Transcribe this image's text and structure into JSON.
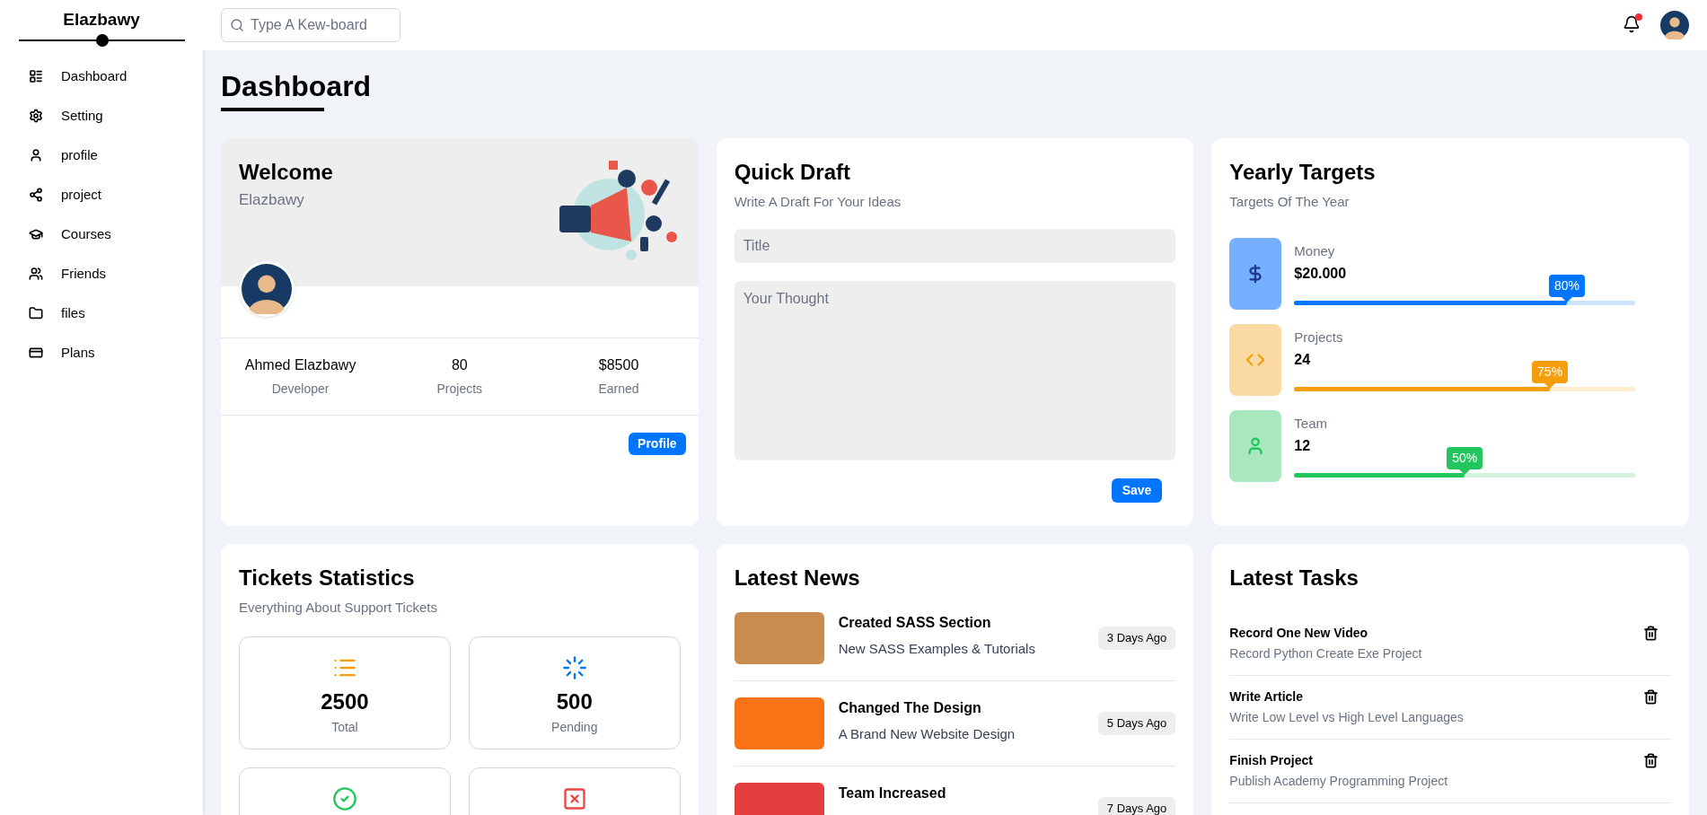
{
  "brand": "Elazbawy",
  "sidebar": {
    "items": [
      {
        "label": "Dashboard",
        "kind": "chart"
      },
      {
        "label": "Setting",
        "kind": "gear"
      },
      {
        "label": "profile",
        "kind": "user"
      },
      {
        "label": "project",
        "kind": "nodes"
      },
      {
        "label": "Courses",
        "kind": "cap"
      },
      {
        "label": "Friends",
        "kind": "users"
      },
      {
        "label": "files",
        "kind": "folder"
      },
      {
        "label": "Plans",
        "kind": "card"
      }
    ]
  },
  "search": {
    "placeholder": "Type A Kew-board"
  },
  "notifications": {
    "unread": true
  },
  "page_title": "Dashboard",
  "welcome": {
    "title": "Welcome",
    "subtitle": "Elazbawy",
    "stats": [
      {
        "value": "Ahmed Elazbawy",
        "label": "Developer"
      },
      {
        "value": "80",
        "label": "Projects"
      },
      {
        "value": "$8500",
        "label": "Earned"
      }
    ],
    "button": "Profile"
  },
  "quick_draft": {
    "title": "Quick Draft",
    "subtitle": "Write A Draft For Your Ideas",
    "title_placeholder": "Title",
    "body_placeholder": "Your Thought",
    "button": "Save"
  },
  "yearly_targets": {
    "title": "Yearly Targets",
    "subtitle": "Targets Of The Year",
    "items": [
      {
        "kind": "money",
        "label": "Money",
        "value": "$20.000",
        "level": 0.8,
        "reading": "80%",
        "color": "#0075ff"
      },
      {
        "kind": "code",
        "label": "Projects",
        "value": "24",
        "level": 0.75,
        "reading": "75%",
        "color": "#f59e0b"
      },
      {
        "kind": "team",
        "label": "Team",
        "value": "12",
        "level": 0.5,
        "reading": "50%",
        "color": "#22c55e"
      }
    ]
  },
  "tickets": {
    "title": "Tickets Statistics",
    "subtitle": "Everything About Support Tickets",
    "items": [
      {
        "kind": "total",
        "value": "2500",
        "label": "Total"
      },
      {
        "kind": "pending",
        "value": "500",
        "label": "Pending"
      },
      {
        "kind": "closed"
      },
      {
        "kind": "deleted"
      }
    ]
  },
  "news": {
    "title": "Latest News",
    "items": [
      {
        "title": "Created SASS Section",
        "text": "New SASS Examples & Tutorials",
        "date": "3 Days Ago"
      },
      {
        "title": "Changed The Design",
        "text": "A Brand New Website Design",
        "date": "5 Days Ago"
      },
      {
        "title": "Team Increased",
        "date": "7 Days Ago"
      }
    ]
  },
  "tasks": {
    "title": "Latest Tasks",
    "items": [
      {
        "title": "Record One New Video",
        "text": "Record Python Create Exe Project"
      },
      {
        "title": "Write Article",
        "text": "Write Low Level vs High Level Languages"
      },
      {
        "title": "Finish Project",
        "text": "Publish Academy Programming Project"
      }
    ]
  }
}
